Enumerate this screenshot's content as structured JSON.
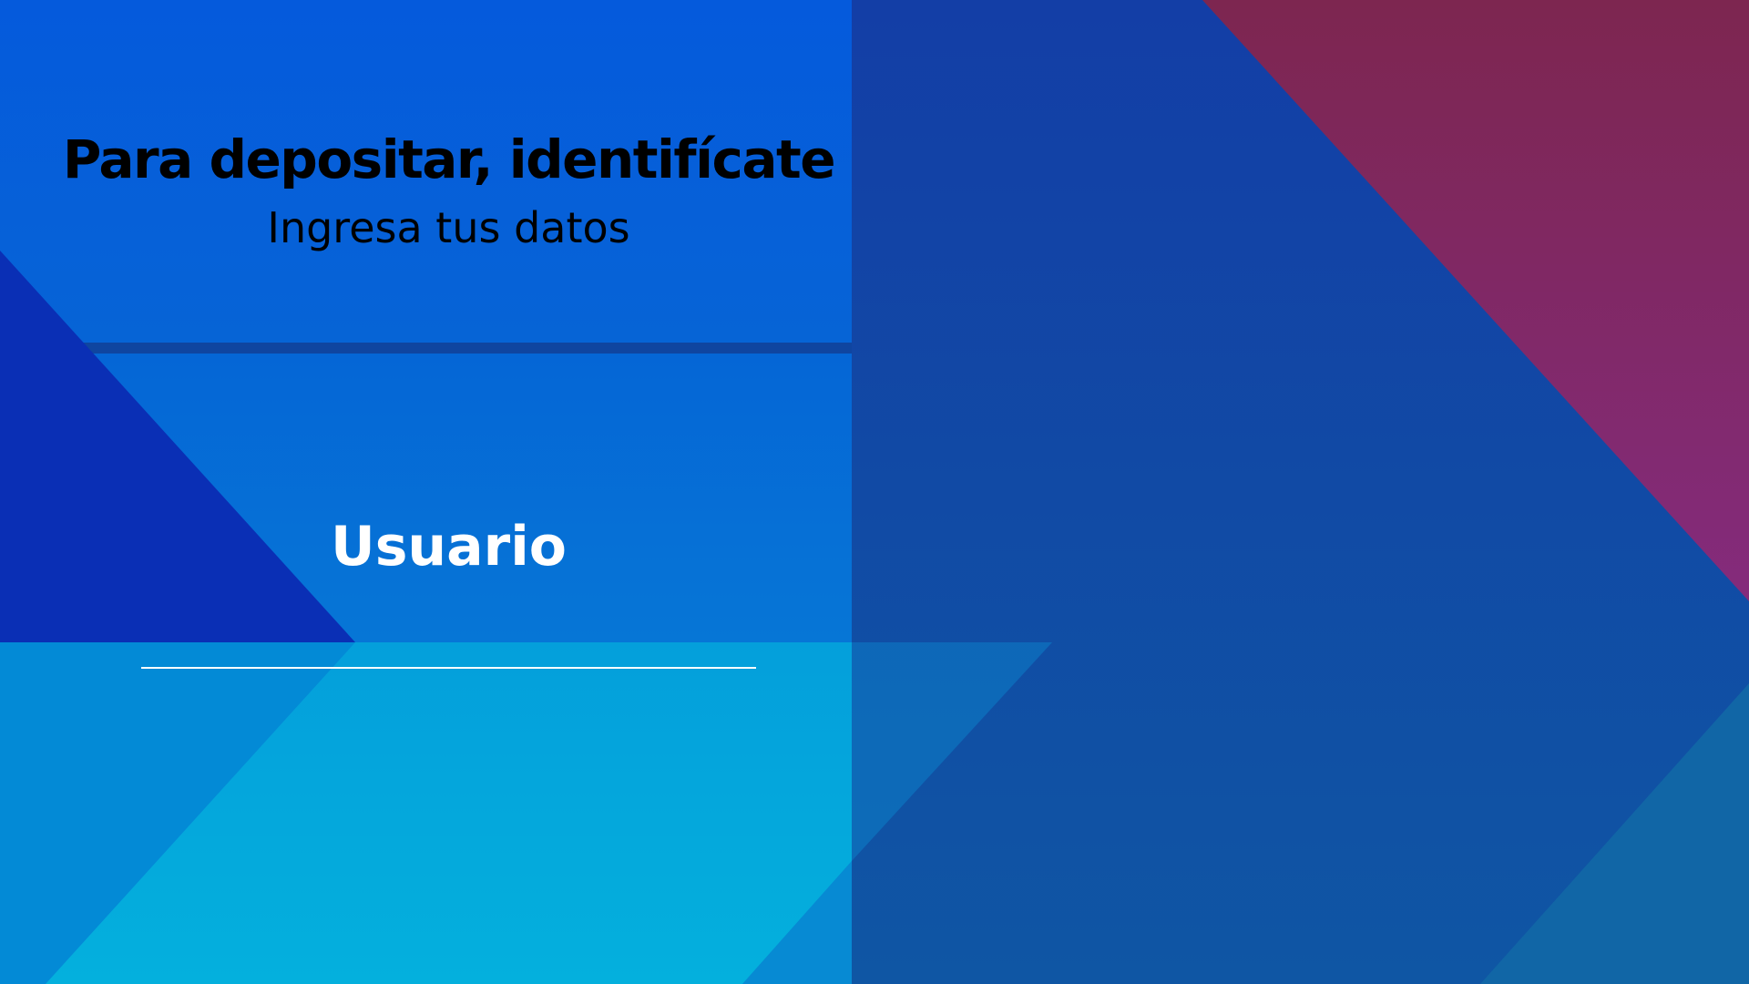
{
  "form": {
    "title": "Para depositar, identifícate",
    "subtitle": "Ingresa tus datos",
    "field_label": "Usuario",
    "field_value": ""
  },
  "colors": {
    "base_blue": "#0c55c8",
    "header_blue": "#0659da",
    "right_panel_blue": "#1147a6",
    "divider_blue": "#0f45a0",
    "dark_blue_triangle": "#0a2fb5",
    "magenta_corner": "#822a6b",
    "cyan_bottom": "#05a4dd",
    "text": "#ffffff"
  }
}
